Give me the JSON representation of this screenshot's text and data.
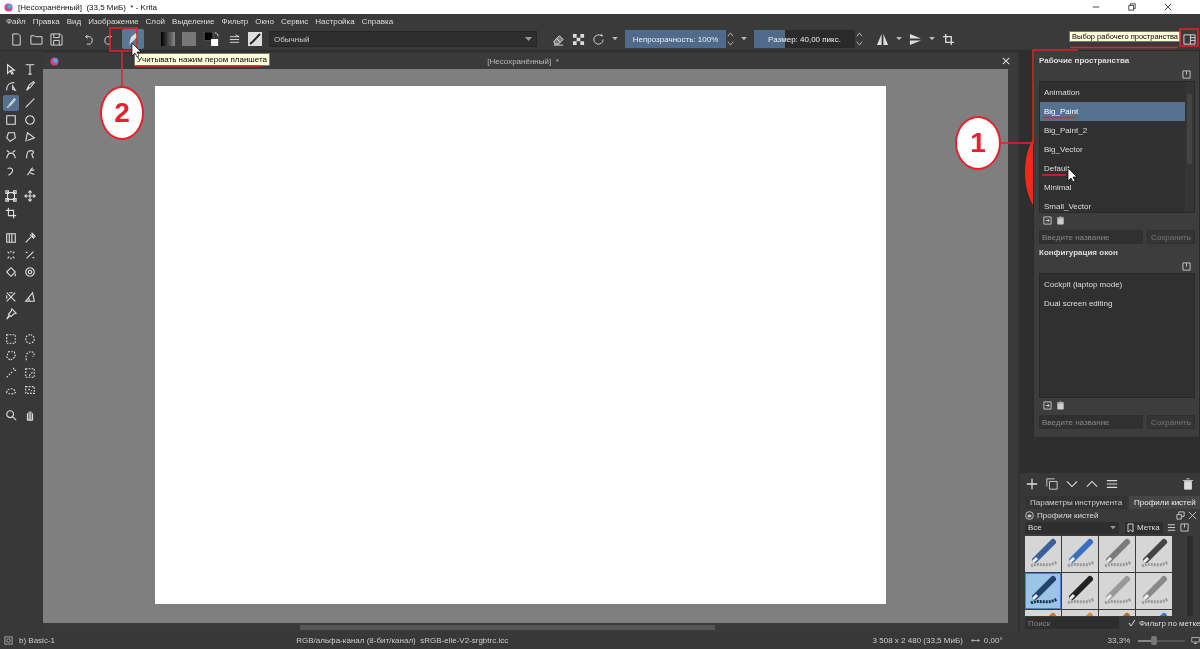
{
  "window": {
    "title": "[Несохранённый]  (33,5 МиБ)  * - Krita"
  },
  "menu": [
    "Файл",
    "Правка",
    "Вид",
    "Изображение",
    "Слой",
    "Выделение",
    "Фильтр",
    "Окно",
    "Сервис",
    "Настройка",
    "Справка"
  ],
  "toolbar": {
    "pressure_button": {
      "on": true
    },
    "blend_mode": "Обычный",
    "opacity": {
      "text": "Непрозрачность: 100%",
      "level": 1
    },
    "size": {
      "text": "Размер: 40,00 пикс.",
      "level": 0.31
    }
  },
  "tooltips": [
    {
      "text": "Учитывать нажим пером планшета"
    },
    {
      "text": "Выбор рабочего пространства"
    }
  ],
  "document_tab": {
    "title": "[Несохранённый]  *"
  },
  "toolbox": {
    "groups": [
      {
        "tools": [
          {
            "selected": false
          },
          {
            "selected": false
          },
          {
            "selected": false
          },
          {
            "selected": false
          },
          {
            "selected": true
          },
          {
            "selected": false
          },
          {
            "selected": false
          },
          {
            "selected": false
          },
          {
            "selected": false
          },
          {
            "selected": false
          },
          {
            "selected": false
          },
          {
            "selected": false
          },
          {
            "selected": false
          },
          {
            "selected": false
          }
        ]
      },
      {
        "tools": [
          {
            "selected": false
          },
          {
            "selected": false
          },
          {
            "selected": false
          }
        ]
      },
      {
        "tools": [
          {
            "selected": false
          },
          {
            "selected": false
          },
          {
            "selected": false
          },
          {
            "selected": false
          },
          {
            "selected": false
          },
          {
            "selected": false
          }
        ]
      },
      {
        "tools": [
          {
            "selected": false
          },
          {
            "selected": false
          },
          {
            "selected": false
          }
        ]
      },
      {
        "tools": [
          {
            "selected": false
          },
          {
            "selected": false
          },
          {
            "selected": false
          },
          {
            "selected": false
          },
          {
            "selected": false
          },
          {
            "selected": false
          },
          {
            "selected": false
          },
          {
            "selected": false
          }
        ]
      },
      {
        "tools": [
          {
            "selected": false
          },
          {
            "selected": false
          }
        ]
      }
    ]
  },
  "workspaces": {
    "title": "Рабочие пространства",
    "items": [
      {
        "label": "Animation",
        "selected": false
      },
      {
        "label": "Big_Paint",
        "selected": true
      },
      {
        "label": "Big_Paint_2",
        "selected": false
      },
      {
        "label": "Big_Vector",
        "selected": false
      },
      {
        "label": "Default",
        "selected": false
      },
      {
        "label": "Minimal",
        "selected": false
      },
      {
        "label": "Small_Vector",
        "selected": false
      }
    ],
    "name_field": {
      "placeholder": "Введите название"
    },
    "save_button": {
      "label": "Сохранить",
      "disabled": true
    }
  },
  "window_layouts": {
    "title": "Конфигурация окон",
    "items": [
      {
        "label": "Cockpit (laptop mode)",
        "selected": false
      },
      {
        "label": "Dual screen editing",
        "selected": false
      }
    ],
    "name_field": {
      "placeholder": "Введите название"
    },
    "save_button": {
      "label": "Сохранить",
      "disabled": true
    }
  },
  "brush_docker": {
    "tabs": [
      {
        "label": "Параметры инструмента",
        "selected": false
      },
      {
        "label": "Профили кистей",
        "selected": true
      }
    ],
    "title": "Профили кистей",
    "filter": "Все",
    "tag_button": "Метка",
    "presets": [
      {
        "selected": false
      },
      {
        "selected": false
      },
      {
        "selected": false
      },
      {
        "selected": false
      },
      {
        "selected": true
      },
      {
        "selected": false
      },
      {
        "selected": false
      },
      {
        "selected": false
      },
      {
        "selected": false
      },
      {
        "selected": false
      },
      {
        "selected": false
      },
      {
        "selected": false
      }
    ],
    "search": {
      "placeholder": "Поиск"
    },
    "tag_filter": {
      "label": "Фильтр по метке",
      "checked": true
    }
  },
  "annotations": [
    {
      "label": "1"
    },
    {
      "label": "2"
    }
  ],
  "status_bar": {
    "brush": "b) Basic-1",
    "color_space": "RGB/альфа-канал (8-бит/канал)  sRGB-elle-V2-srgbtrc.icc",
    "image_size": "3 508 x 2 480 (33,5 МиБ)",
    "rotation": "0,00°",
    "zoom": "33,3%",
    "zoom_slider": {
      "level": 0.3
    }
  }
}
